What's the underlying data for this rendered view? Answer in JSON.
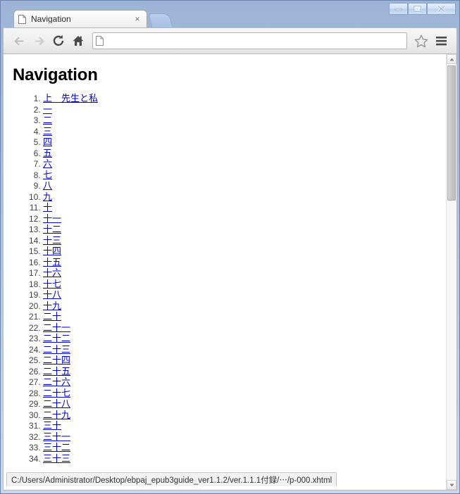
{
  "window": {
    "caption_buttons": [
      {
        "name": "minimize",
        "label": "Minimize"
      },
      {
        "name": "maximize",
        "label": "Maximize"
      },
      {
        "name": "close",
        "label": "Close"
      }
    ]
  },
  "tabstrip": {
    "tabs": [
      {
        "title": "Navigation",
        "favicon": "page-icon",
        "close_label": "×"
      }
    ],
    "new_tab_label": ""
  },
  "toolbar": {
    "back_icon": "arrow-left-icon",
    "forward_icon": "arrow-right-icon",
    "reload_icon": "reload-icon",
    "home_icon": "home-icon",
    "bookmark_icon": "star-icon",
    "menu_icon": "hamburger-menu-icon",
    "omnibox": {
      "value": "",
      "placeholder": "",
      "page_icon": "page-icon"
    }
  },
  "page": {
    "title": "Navigation",
    "toc_items": [
      {
        "label": "上　先生と私"
      },
      {
        "label": "一"
      },
      {
        "label": "二"
      },
      {
        "label": "三"
      },
      {
        "label": "四"
      },
      {
        "label": "五"
      },
      {
        "label": "六"
      },
      {
        "label": "七"
      },
      {
        "label": "八"
      },
      {
        "label": "九"
      },
      {
        "label": "十"
      },
      {
        "label": "十一"
      },
      {
        "label": "十二"
      },
      {
        "label": "十三"
      },
      {
        "label": "十四"
      },
      {
        "label": "十五"
      },
      {
        "label": "十六"
      },
      {
        "label": "十七"
      },
      {
        "label": "十八"
      },
      {
        "label": "十九"
      },
      {
        "label": "二十"
      },
      {
        "label": "二十一"
      },
      {
        "label": "二十二"
      },
      {
        "label": "二十三"
      },
      {
        "label": "二十四"
      },
      {
        "label": "二十五"
      },
      {
        "label": "二十六"
      },
      {
        "label": "二十七"
      },
      {
        "label": "二十八"
      },
      {
        "label": "二十九"
      },
      {
        "label": "三十"
      },
      {
        "label": "三十一"
      },
      {
        "label": "三十二"
      },
      {
        "label": "三十三"
      }
    ]
  },
  "statusbar": {
    "text": "C:/Users/Administrator/Desktop/ebpaj_epub3guide_ver1.1.2/ver.1.1.1付録/⋯/p-000.xhtml"
  },
  "scrollbar": {
    "up_arrow": "▲",
    "down_arrow": "▼"
  },
  "colors": {
    "link": "#0000cc",
    "frame": "#9db4d6",
    "text": "#000000"
  }
}
